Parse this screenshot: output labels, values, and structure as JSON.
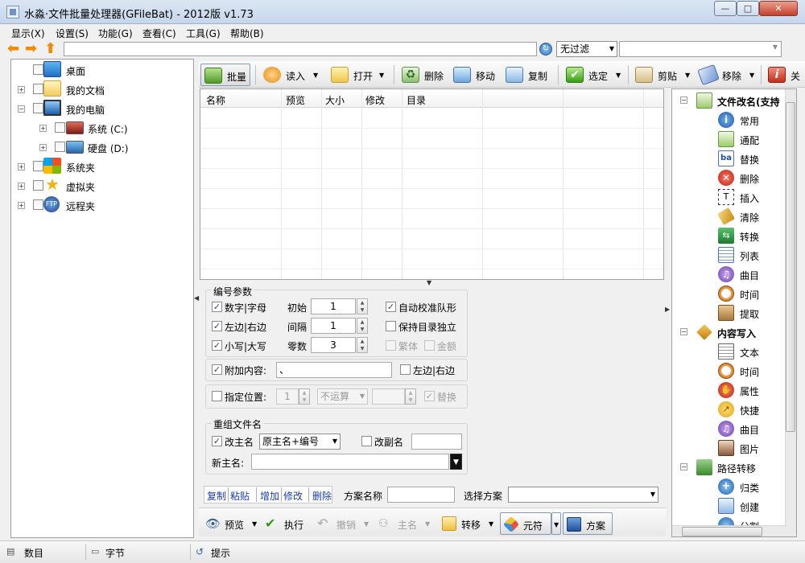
{
  "window": {
    "title": "水淼·文件批量处理器(GFileBat) - 2012版 v1.73"
  },
  "menu": [
    "显示(X)",
    "设置(S)",
    "功能(G)",
    "查看(C)",
    "工具(G)",
    "帮助(B)"
  ],
  "address": {
    "path": "",
    "filter": "无过滤",
    "filter_text": ""
  },
  "tree": [
    {
      "label": "桌面",
      "icon": "desktop-icon"
    },
    {
      "label": "我的文档",
      "icon": "folder-icon"
    },
    {
      "label": "我的电脑",
      "icon": "computer-icon"
    },
    {
      "label": "系统 (C:)",
      "icon": "drive-icon"
    },
    {
      "label": "硬盘 (D:)",
      "icon": "drive-icon"
    },
    {
      "label": "系统夹",
      "icon": "windows-icon"
    },
    {
      "label": "虚拟夹",
      "icon": "star-icon"
    },
    {
      "label": "远程夹",
      "icon": "ftp-icon"
    }
  ],
  "toolbar": {
    "batch": "批量",
    "read": "读入",
    "open": "打开",
    "delete": "删除",
    "move": "移动",
    "copy": "复制",
    "select": "选定",
    "cut": "剪贴",
    "remove": "移除",
    "close": "关"
  },
  "filelist": {
    "columns": [
      "名称",
      "预览",
      "大小",
      "修改",
      "目录"
    ]
  },
  "numbering": {
    "title": "编号参数",
    "digit_alpha": "数字|字母",
    "start_label": "初始",
    "start": "1",
    "auto_align": "自动校准队形",
    "left_right": "左边|右边",
    "step_label": "间隔",
    "step": "1",
    "keep_dir": "保持目录独立",
    "lower_upper": "小写|大写",
    "zeros_label": "零数",
    "zeros": "3",
    "traditional": "繁体",
    "amount": "金额"
  },
  "append": {
    "label": "附加内容:",
    "value": "、",
    "left_right": "左边|右边"
  },
  "position": {
    "label": "指定位置:",
    "value": "1",
    "op": "不运算",
    "op_value": "",
    "replace": "替换"
  },
  "rename": {
    "title": "重组文件名",
    "main_label": "改主名",
    "main_value": "原主名+编号",
    "ext_label": "改副名",
    "ext_value": "",
    "new_main_label": "新主名:",
    "new_main_value": ""
  },
  "scheme": {
    "copy": "复制",
    "paste": "粘贴",
    "add": "增加",
    "modify": "修改",
    "delete": "删除",
    "name_label": "方案名称",
    "name_value": "",
    "select_label": "选择方案",
    "select_value": ""
  },
  "actions": {
    "preview": "预览",
    "execute": "执行",
    "undo": "撤销",
    "main_name": "主名",
    "transfer": "转移",
    "yuan_fu": "元符",
    "scheme": "方案"
  },
  "right_tree": {
    "group1": "文件改名(支持",
    "group1_items": [
      "常用",
      "通配",
      "替换",
      "删除",
      "插入",
      "清除",
      "转换",
      "列表",
      "曲目",
      "时间",
      "提取"
    ],
    "group2": "内容写入",
    "group2_items": [
      "文本",
      "时间",
      "属性",
      "快捷",
      "曲目",
      "图片"
    ],
    "group3": "路径转移",
    "group3_items": [
      "归类",
      "创建",
      "分割"
    ]
  },
  "status": {
    "count": "数目",
    "bytes": "字节",
    "hint": "提示"
  },
  "colors": {
    "accent_orange": "#f08a00",
    "link_blue": "#1a3eaa",
    "close_red": "#c5412a"
  }
}
